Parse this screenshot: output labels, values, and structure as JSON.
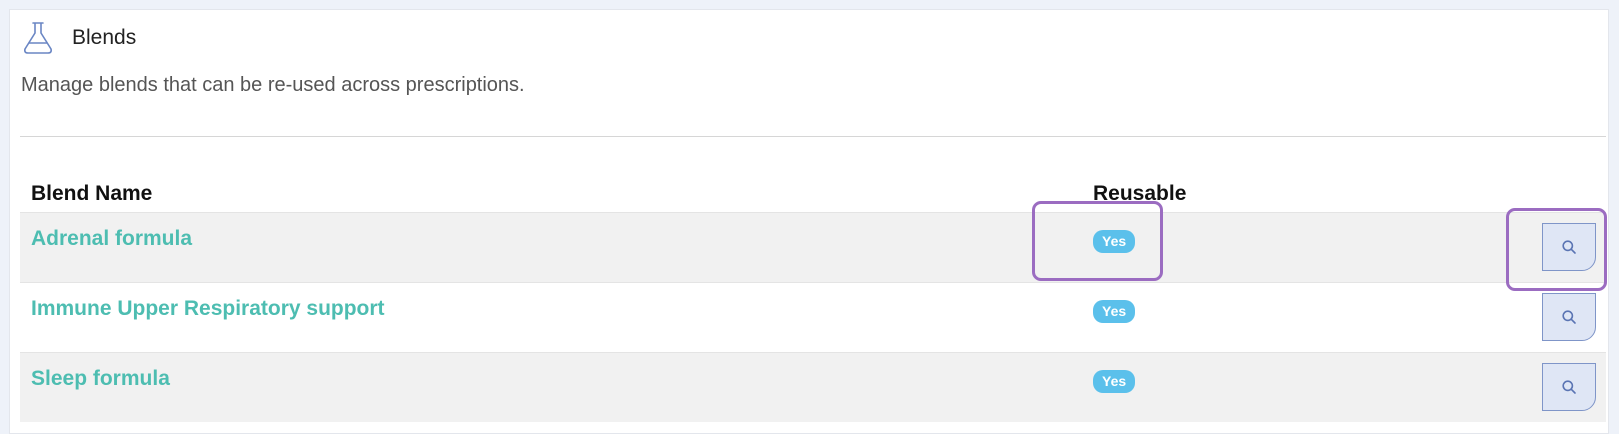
{
  "header": {
    "icon": "flask-icon",
    "title": "Blends",
    "subtitle": "Manage blends that can be re-used across prescriptions."
  },
  "table": {
    "columns": {
      "name": "Blend Name",
      "reusable": "Reusable"
    },
    "rows": [
      {
        "name": "Adrenal formula",
        "reusable": "Yes"
      },
      {
        "name": "Immune Upper Respiratory support",
        "reusable": "Yes"
      },
      {
        "name": "Sleep formula",
        "reusable": "Yes"
      }
    ],
    "action_icon": "search-icon"
  },
  "colors": {
    "link": "#4dbdb1",
    "badge": "#5bc0eb",
    "highlight": "#9b6cc1",
    "button_bg": "#dfe6f5",
    "button_border": "#7f95c8"
  }
}
